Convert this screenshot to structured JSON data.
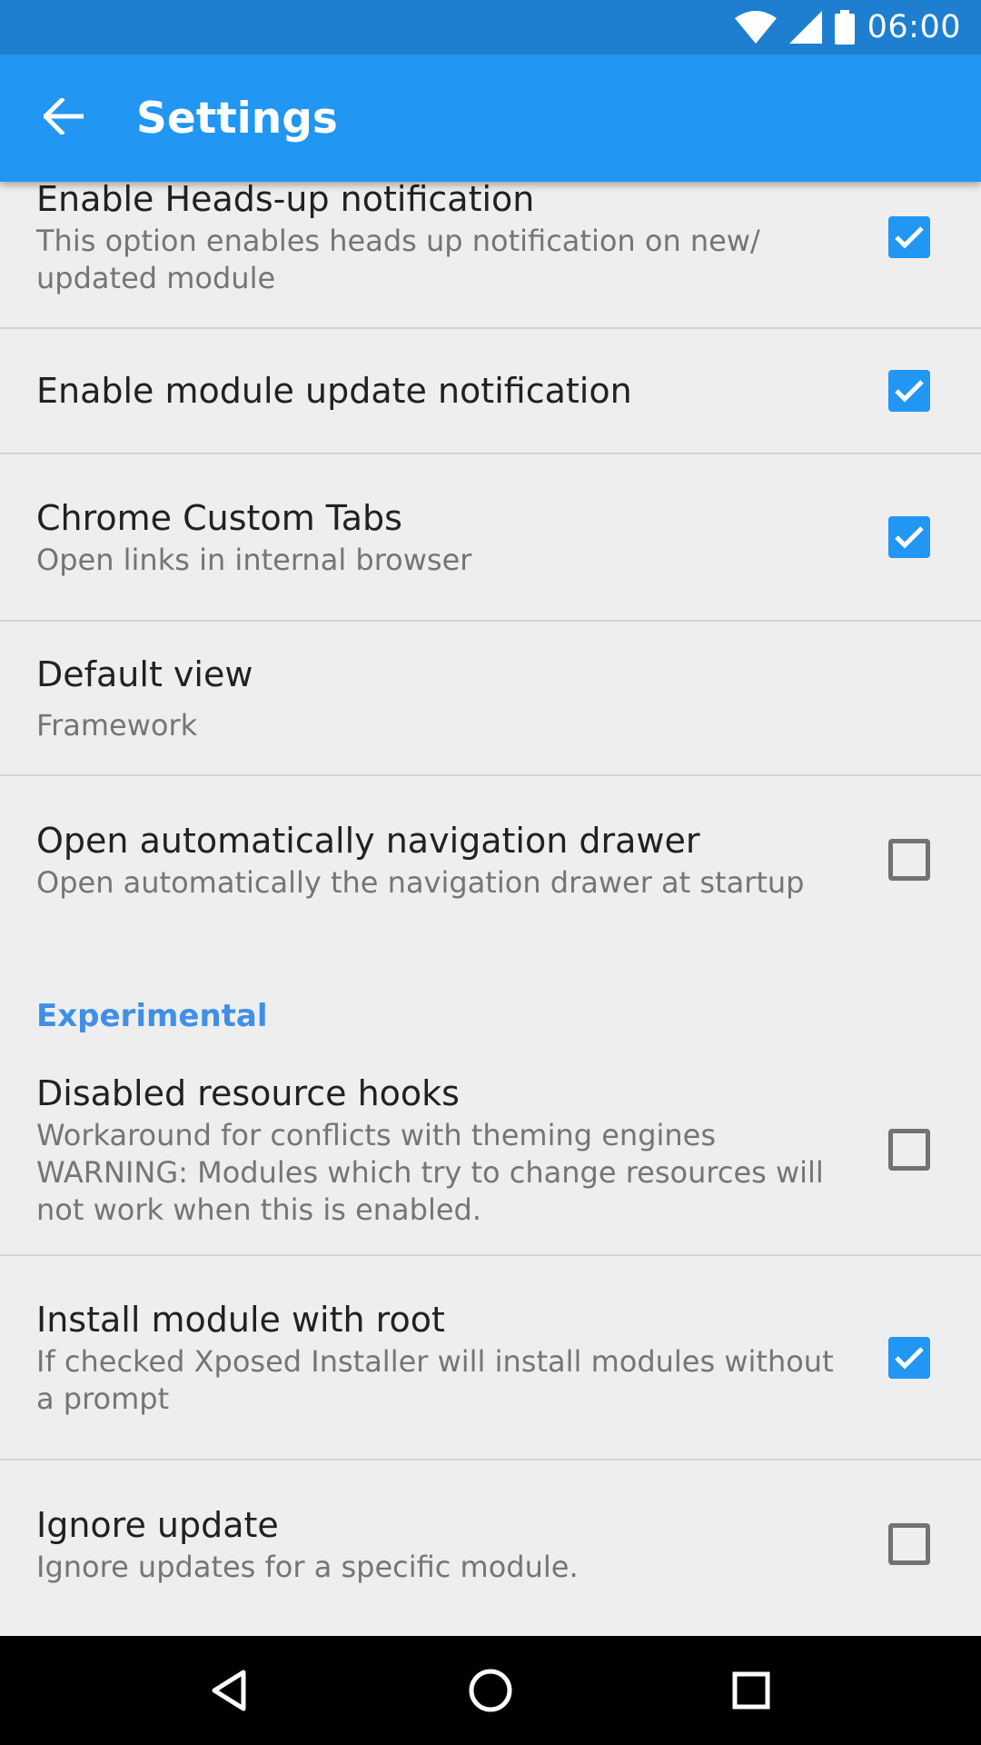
{
  "status_bar": {
    "time": "06:00",
    "icons": [
      "wifi-icon",
      "cell-signal-icon",
      "battery-icon"
    ]
  },
  "app_bar": {
    "title": "Settings",
    "back_icon": "arrow-back-icon",
    "color": "#2196f3"
  },
  "prefs": [
    {
      "title": "Enable Heads-up notification",
      "summary": [
        "This option enables heads up notification on new/",
        "updated module"
      ],
      "checked": true
    },
    {
      "title": "Enable module update notification",
      "checked": true
    },
    {
      "title": "Chrome Custom Tabs",
      "summary": [
        "Open links in internal browser"
      ],
      "checked": true
    },
    {
      "title": "Default view",
      "summary": [
        "Framework"
      ]
    },
    {
      "title": "Open automatically navigation drawer",
      "summary": [
        "Open automatically the navigation drawer at startup"
      ],
      "checked": false
    }
  ],
  "category": {
    "title": "Experimental",
    "color": "#3f8fe8"
  },
  "experimental_prefs": [
    {
      "title": "Disabled resource hooks",
      "summary": [
        "Workaround for conflicts with theming engines",
        "WARNING: Modules which try to change resources will",
        "not work when this is enabled."
      ],
      "checked": false
    },
    {
      "title": "Install module with root",
      "summary": [
        "If checked Xposed Installer will install modules without",
        "a prompt"
      ],
      "checked": true
    },
    {
      "title": "Ignore update",
      "summary": [
        "Ignore updates for a specific module."
      ],
      "checked": false
    }
  ],
  "nav_bar": {
    "buttons": [
      "back-triangle-icon",
      "home-circle-icon",
      "recents-square-icon"
    ]
  }
}
